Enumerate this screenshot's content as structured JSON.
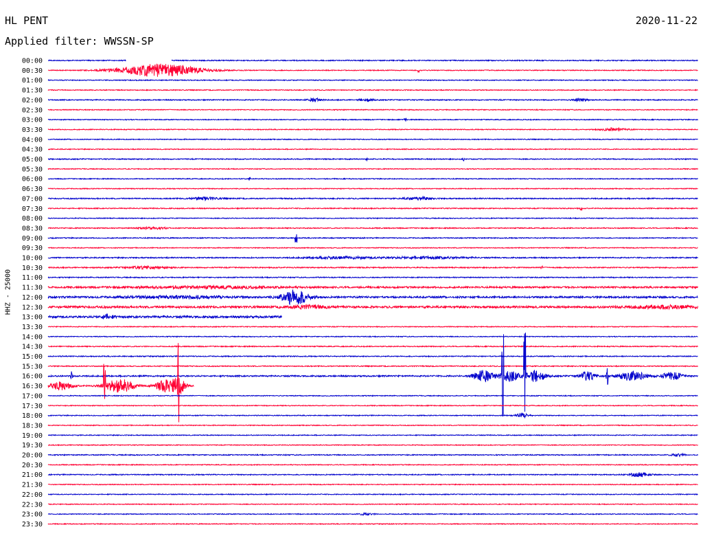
{
  "header": {
    "station": "HL PENT",
    "date": "2020-11-22",
    "filter_label": "Applied filter: WWSSN-SP",
    "channel_label": "HHZ - 25000"
  },
  "chart_data": {
    "type": "line",
    "title": "HL PENT",
    "subtitle": "Applied filter: WWSSN-SP",
    "ylabel": "HHZ - 25000",
    "colors": [
      "#0000cc",
      "#ff0033"
    ],
    "grid": false,
    "row_labels": [
      "00:00",
      "00:30",
      "01:00",
      "01:30",
      "02:00",
      "02:30",
      "03:00",
      "03:30",
      "04:00",
      "04:30",
      "05:00",
      "05:30",
      "06:00",
      "06:30",
      "07:00",
      "07:30",
      "08:00",
      "08:30",
      "09:00",
      "09:30",
      "10:00",
      "10:30",
      "11:00",
      "11:30",
      "12:00",
      "12:30",
      "13:00",
      "13:30",
      "14:00",
      "14:30",
      "15:00",
      "15:30",
      "16:00",
      "16:30",
      "17:00",
      "17:30",
      "18:00",
      "18:30",
      "19:00",
      "19:30",
      "20:00",
      "20:30",
      "21:00",
      "21:30",
      "22:00",
      "22:30",
      "23:00",
      "23:30"
    ],
    "rows": [
      {
        "noise": 0.7,
        "bursts": [],
        "spikes": [],
        "gaps": [
          [
            0.12,
            0.19
          ]
        ]
      },
      {
        "noise": 0.6,
        "bursts": [
          [
            0.17,
            0.06,
            9
          ]
        ],
        "spikes": [
          [
            0.57,
            2
          ]
        ],
        "gaps": []
      },
      {
        "noise": 0.6,
        "bursts": [],
        "spikes": [],
        "gaps": []
      },
      {
        "noise": 0.6,
        "bursts": [],
        "spikes": [],
        "gaps": []
      },
      {
        "noise": 0.7,
        "bursts": [
          [
            0.41,
            0.01,
            2
          ],
          [
            0.49,
            0.01,
            2
          ],
          [
            0.82,
            0.01,
            2
          ]
        ],
        "spikes": [],
        "gaps": []
      },
      {
        "noise": 0.6,
        "bursts": [],
        "spikes": [],
        "gaps": []
      },
      {
        "noise": 0.6,
        "bursts": [],
        "spikes": [
          [
            0.55,
            2
          ]
        ],
        "gaps": []
      },
      {
        "noise": 0.6,
        "bursts": [
          [
            0.87,
            0.02,
            2
          ]
        ],
        "spikes": [],
        "gaps": []
      },
      {
        "noise": 0.6,
        "bursts": [],
        "spikes": [],
        "gaps": []
      },
      {
        "noise": 0.6,
        "bursts": [],
        "spikes": [],
        "gaps": []
      },
      {
        "noise": 0.7,
        "bursts": [],
        "spikes": [
          [
            0.49,
            2
          ],
          [
            0.64,
            2
          ]
        ],
        "gaps": []
      },
      {
        "noise": 0.6,
        "bursts": [],
        "spikes": [],
        "gaps": []
      },
      {
        "noise": 0.6,
        "bursts": [],
        "spikes": [
          [
            0.31,
            2
          ]
        ],
        "gaps": []
      },
      {
        "noise": 0.6,
        "bursts": [],
        "spikes": [],
        "gaps": []
      },
      {
        "noise": 0.8,
        "bursts": [
          [
            0.24,
            0.02,
            2
          ],
          [
            0.57,
            0.02,
            2
          ]
        ],
        "spikes": [],
        "gaps": []
      },
      {
        "noise": 0.7,
        "bursts": [],
        "spikes": [
          [
            0.82,
            2
          ]
        ],
        "gaps": []
      },
      {
        "noise": 0.6,
        "bursts": [],
        "spikes": [],
        "gaps": []
      },
      {
        "noise": 0.7,
        "bursts": [
          [
            0.16,
            0.02,
            1.5
          ]
        ],
        "spikes": [],
        "gaps": []
      },
      {
        "noise": 0.7,
        "bursts": [],
        "spikes": [
          [
            0.382,
            9
          ]
        ],
        "gaps": []
      },
      {
        "noise": 0.6,
        "bursts": [],
        "spikes": [],
        "gaps": []
      },
      {
        "noise": 0.8,
        "bursts": [
          [
            0.45,
            0.05,
            1.5
          ],
          [
            0.58,
            0.06,
            1.5
          ]
        ],
        "spikes": [],
        "gaps": []
      },
      {
        "noise": 0.8,
        "bursts": [
          [
            0.15,
            0.03,
            1.5
          ]
        ],
        "spikes": [
          [
            0.76,
            3
          ]
        ],
        "gaps": []
      },
      {
        "noise": 0.7,
        "bursts": [],
        "spikes": [],
        "gaps": []
      },
      {
        "noise": 1.2,
        "bursts": [
          [
            0.25,
            0.1,
            1.5
          ]
        ],
        "spikes": [],
        "gaps": []
      },
      {
        "noise": 1.3,
        "bursts": [
          [
            0.38,
            0.02,
            11
          ],
          [
            0.2,
            0.08,
            1.5
          ]
        ],
        "spikes": [],
        "gaps": []
      },
      {
        "noise": 1.5,
        "bursts": [
          [
            0.4,
            0.03,
            2
          ],
          [
            0.95,
            0.05,
            2
          ]
        ],
        "spikes": [],
        "gaps": []
      },
      {
        "noise": 1.5,
        "bursts": [
          [
            0.09,
            0.01,
            3
          ]
        ],
        "spikes": [],
        "gaps": [
          [
            0.36,
            1.0
          ]
        ]
      },
      {
        "noise": 0.6,
        "bursts": [],
        "spikes": [],
        "gaps": []
      },
      {
        "noise": 0.6,
        "bursts": [],
        "spikes": [],
        "gaps": []
      },
      {
        "noise": 0.7,
        "bursts": [],
        "spikes": [],
        "gaps": []
      },
      {
        "noise": 0.7,
        "bursts": [],
        "spikes": [],
        "gaps": []
      },
      {
        "noise": 0.7,
        "bursts": [],
        "spikes": [],
        "gaps": []
      },
      {
        "noise": 1.0,
        "bursts": [
          [
            0.67,
            0.015,
            8
          ],
          [
            0.71,
            0.015,
            7
          ],
          [
            0.75,
            0.015,
            8
          ],
          [
            0.83,
            0.012,
            6
          ],
          [
            0.9,
            0.02,
            7
          ],
          [
            0.96,
            0.015,
            5
          ]
        ],
        "spikes": [
          [
            0.7,
            55
          ],
          [
            0.734,
            70
          ],
          [
            0.036,
            6
          ],
          [
            0.86,
            14
          ]
        ],
        "gaps": []
      },
      {
        "noise": 1.0,
        "bursts": [
          [
            0.02,
            0.015,
            6
          ],
          [
            0.11,
            0.02,
            10
          ],
          [
            0.18,
            0.015,
            8
          ],
          [
            0.2,
            0.01,
            12
          ]
        ],
        "spikes": [
          [
            0.087,
            30
          ],
          [
            0.2,
            50
          ]
        ],
        "gaps": [
          [
            0.225,
            1.0
          ]
        ]
      },
      {
        "noise": 0.6,
        "bursts": [],
        "spikes": [],
        "gaps": []
      },
      {
        "noise": 0.6,
        "bursts": [],
        "spikes": [],
        "gaps": []
      },
      {
        "noise": 0.6,
        "bursts": [
          [
            0.73,
            0.01,
            3
          ]
        ],
        "spikes": [],
        "gaps": []
      },
      {
        "noise": 0.6,
        "bursts": [],
        "spikes": [],
        "gaps": []
      },
      {
        "noise": 0.6,
        "bursts": [],
        "spikes": [],
        "gaps": []
      },
      {
        "noise": 0.6,
        "bursts": [],
        "spikes": [],
        "gaps": []
      },
      {
        "noise": 0.7,
        "bursts": [
          [
            0.97,
            0.01,
            2
          ]
        ],
        "spikes": [],
        "gaps": []
      },
      {
        "noise": 0.6,
        "bursts": [],
        "spikes": [],
        "gaps": []
      },
      {
        "noise": 0.7,
        "bursts": [
          [
            0.91,
            0.015,
            3
          ]
        ],
        "spikes": [],
        "gaps": []
      },
      {
        "noise": 0.6,
        "bursts": [],
        "spikes": [],
        "gaps": []
      },
      {
        "noise": 0.6,
        "bursts": [],
        "spikes": [],
        "gaps": []
      },
      {
        "noise": 0.6,
        "bursts": [],
        "spikes": [],
        "gaps": []
      },
      {
        "noise": 0.6,
        "bursts": [
          [
            0.49,
            0.01,
            1.5
          ]
        ],
        "spikes": [],
        "gaps": []
      },
      {
        "noise": 0.6,
        "bursts": [],
        "spikes": [],
        "gaps": []
      }
    ]
  }
}
